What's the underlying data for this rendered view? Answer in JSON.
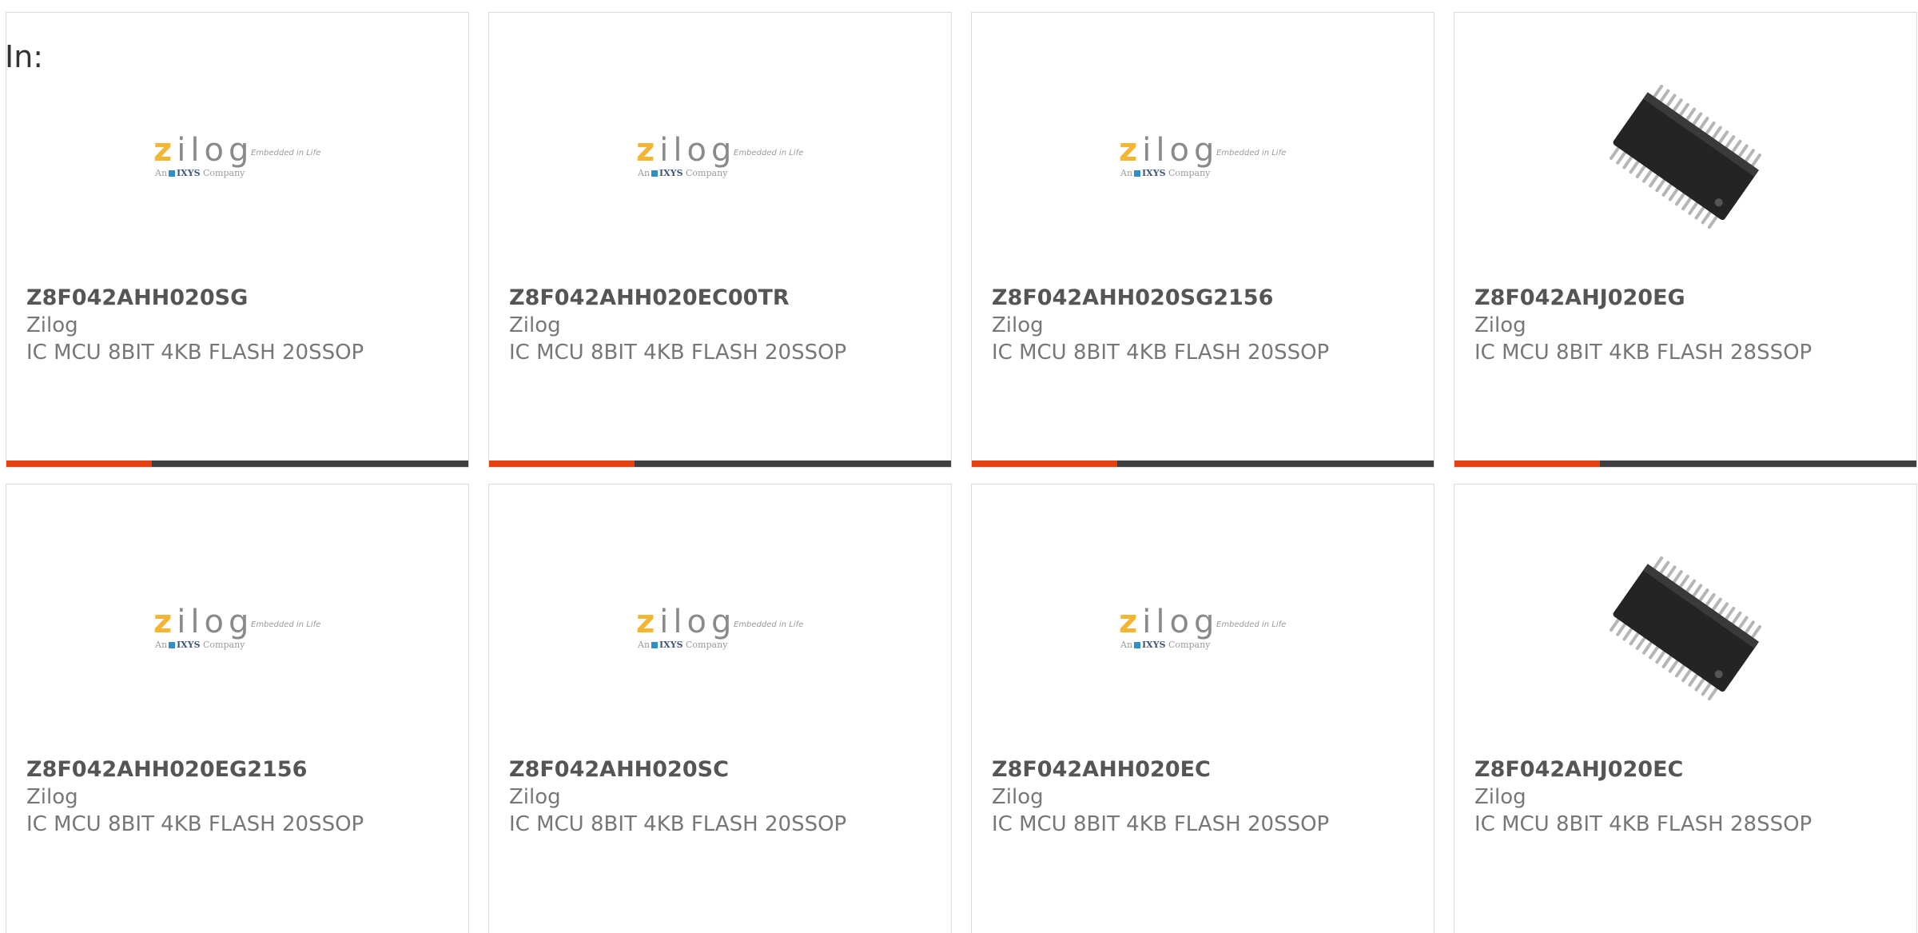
{
  "filter_label": "In:",
  "colors": {
    "accent": "#e5400f",
    "bar_dark": "#3f3f3f",
    "border": "#dcdcdc"
  },
  "logo": {
    "word": "ilog",
    "z": "z",
    "tagline": "Embedded in Life",
    "sub_prefix": "An",
    "sub_brand": "IXYS",
    "sub_suffix": "Company"
  },
  "products": [
    {
      "part": "Z8F042AHH020SG",
      "manufacturer": "Zilog",
      "description": "IC MCU 8BIT 4KB FLASH 20SSOP",
      "image": "zilog-logo-icon"
    },
    {
      "part": "Z8F042AHH020EC00TR",
      "manufacturer": "Zilog",
      "description": "IC MCU 8BIT 4KB FLASH 20SSOP",
      "image": "zilog-logo-icon"
    },
    {
      "part": "Z8F042AHH020SG2156",
      "manufacturer": "Zilog",
      "description": "IC MCU 8BIT 4KB FLASH 20SSOP",
      "image": "zilog-logo-icon"
    },
    {
      "part": "Z8F042AHJ020EG",
      "manufacturer": "Zilog",
      "description": "IC MCU 8BIT 4KB FLASH 28SSOP",
      "image": "ssop-chip-icon"
    },
    {
      "part": "Z8F042AHH020EG2156",
      "manufacturer": "Zilog",
      "description": "IC MCU 8BIT 4KB FLASH 20SSOP",
      "image": "zilog-logo-icon"
    },
    {
      "part": "Z8F042AHH020SC",
      "manufacturer": "Zilog",
      "description": "IC MCU 8BIT 4KB FLASH 20SSOP",
      "image": "zilog-logo-icon"
    },
    {
      "part": "Z8F042AHH020EC",
      "manufacturer": "Zilog",
      "description": "IC MCU 8BIT 4KB FLASH 20SSOP",
      "image": "zilog-logo-icon"
    },
    {
      "part": "Z8F042AHJ020EC",
      "manufacturer": "Zilog",
      "description": "IC MCU 8BIT 4KB FLASH 28SSOP",
      "image": "ssop-chip-icon"
    }
  ]
}
